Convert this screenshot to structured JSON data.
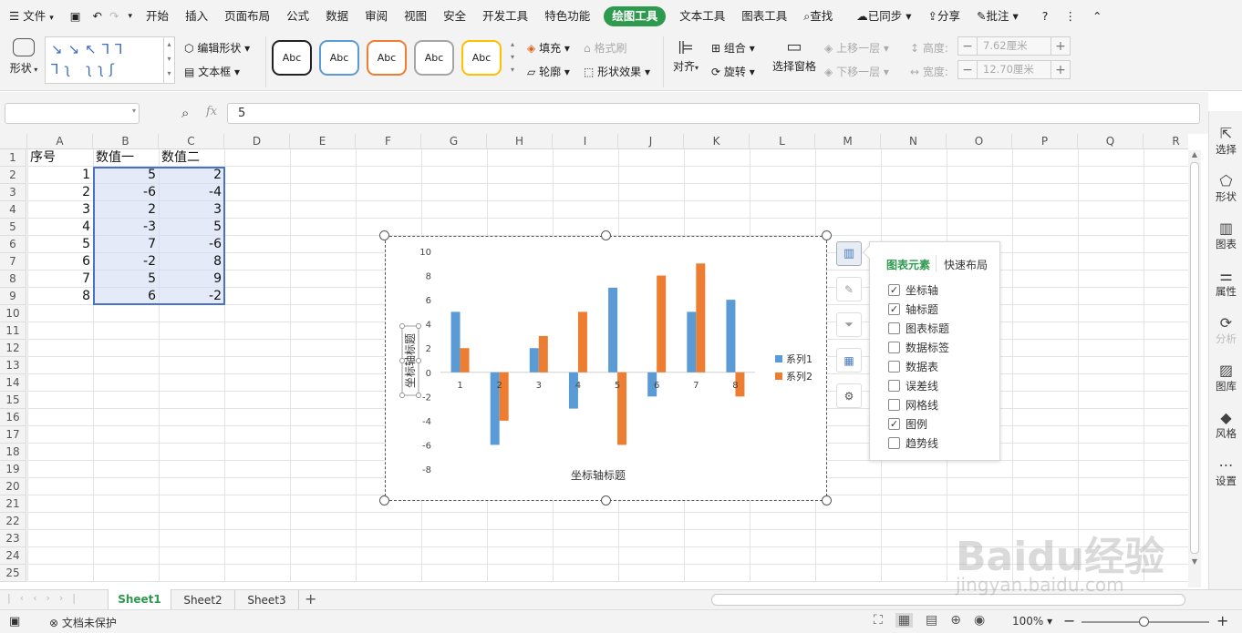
{
  "menu": {
    "file": "文件",
    "tabs": [
      "开始",
      "插入",
      "页面布局",
      "公式",
      "数据",
      "审阅",
      "视图",
      "安全",
      "开发工具",
      "特色功能",
      "绘图工具",
      "文本工具",
      "图表工具"
    ],
    "active_tab": "绘图工具",
    "search": "查找",
    "sync": "已同步",
    "share": "分享",
    "comment": "批注",
    "help": "?"
  },
  "ribbon": {
    "shape": "形状",
    "edit_shape": "编辑形状",
    "textbox": "文本框",
    "style_sample": "Abc",
    "fill": "填充",
    "format_painter": "格式刷",
    "outline": "轮廓",
    "shape_effect": "形状效果",
    "align": "对齐",
    "group": "组合",
    "rotate": "旋转",
    "selection_pane": "选择窗格",
    "bring_forward": "上移一层",
    "send_backward": "下移一层",
    "height_label": "高度:",
    "height_value": "7.62厘米",
    "width_label": "宽度:",
    "width_value": "12.70厘米"
  },
  "formula_bar": {
    "fx": "fx",
    "value": "5"
  },
  "grid": {
    "columns": [
      "A",
      "B",
      "C",
      "D",
      "E",
      "F",
      "G",
      "H",
      "I",
      "J",
      "K",
      "L",
      "M",
      "N",
      "O",
      "P",
      "Q",
      "R"
    ],
    "rows": [
      "1",
      "2",
      "3",
      "4",
      "5",
      "6",
      "7",
      "8",
      "9",
      "10",
      "11",
      "12",
      "13",
      "14",
      "15",
      "16",
      "17",
      "18",
      "19",
      "20",
      "21",
      "22",
      "23",
      "24",
      "25"
    ],
    "headers": [
      "序号",
      "数值一",
      "数值二"
    ],
    "data": [
      [
        "1",
        "5",
        "2"
      ],
      [
        "2",
        "-6",
        "-4"
      ],
      [
        "3",
        "2",
        "3"
      ],
      [
        "4",
        "-3",
        "5"
      ],
      [
        "5",
        "7",
        "-6"
      ],
      [
        "6",
        "-2",
        "8"
      ],
      [
        "7",
        "5",
        "9"
      ],
      [
        "8",
        "6",
        "-2"
      ]
    ]
  },
  "chart_data": {
    "type": "bar",
    "categories": [
      "1",
      "2",
      "3",
      "4",
      "5",
      "6",
      "7",
      "8"
    ],
    "series": [
      {
        "name": "系列1",
        "values": [
          5,
          -6,
          2,
          -3,
          7,
          -2,
          5,
          6
        ],
        "color": "#5b9bd5"
      },
      {
        "name": "系列2",
        "values": [
          2,
          -4,
          3,
          5,
          -6,
          8,
          9,
          -2
        ],
        "color": "#ed7d31"
      }
    ],
    "ylim": [
      -8,
      10
    ],
    "yticks": [
      "10",
      "8",
      "6",
      "4",
      "2",
      "0",
      "-2",
      "-4",
      "-6",
      "-8"
    ],
    "xlabel": "坐标轴标题",
    "ylabel": "坐标轴标题",
    "legend": "right",
    "grid": false
  },
  "chart_elements_popup": {
    "tab_elements": "图表元素",
    "tab_layout": "快速布局",
    "items": [
      {
        "label": "坐标轴",
        "checked": true
      },
      {
        "label": "轴标题",
        "checked": true
      },
      {
        "label": "图表标题",
        "checked": false
      },
      {
        "label": "数据标签",
        "checked": false
      },
      {
        "label": "数据表",
        "checked": false
      },
      {
        "label": "误差线",
        "checked": false
      },
      {
        "label": "网格线",
        "checked": false
      },
      {
        "label": "图例",
        "checked": true
      },
      {
        "label": "趋势线",
        "checked": false
      }
    ]
  },
  "right_panel": [
    "选择",
    "形状",
    "图表",
    "属性",
    "分析",
    "图库",
    "风格",
    "设置"
  ],
  "sheets": {
    "tabs": [
      "Sheet1",
      "Sheet2",
      "Sheet3"
    ],
    "active": "Sheet1",
    "add": "+"
  },
  "status": {
    "protect": "文档未保护",
    "zoom": "100%"
  },
  "watermark": {
    "brand": "Baidu经验",
    "url": "jingyan.baidu.com"
  }
}
